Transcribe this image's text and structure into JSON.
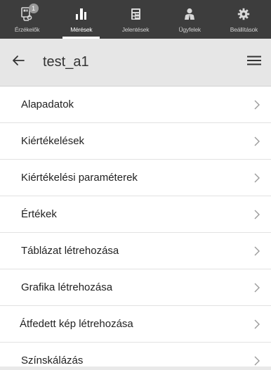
{
  "nav": {
    "items": [
      {
        "label": "Érzékelők",
        "icon": "sensor-icon",
        "badge": "1",
        "active": false
      },
      {
        "label": "Mérések",
        "icon": "bar-chart-icon",
        "active": true
      },
      {
        "label": "Jelentések",
        "icon": "report-icon",
        "active": false
      },
      {
        "label": "Ügyfelek",
        "icon": "clients-icon",
        "active": false
      },
      {
        "label": "Beállítások",
        "icon": "gear-icon",
        "active": false
      }
    ]
  },
  "header": {
    "title": "test_a1",
    "back_icon": "arrow-left-icon",
    "menu_icon": "hamburger-menu-icon"
  },
  "menu": {
    "items": [
      {
        "label": "Alapadatok"
      },
      {
        "label": "Kiértékelések"
      },
      {
        "label": "Kiértékelési paraméterek"
      },
      {
        "label": "Értékek"
      },
      {
        "label": "Táblázat létrehozása"
      },
      {
        "label": "Grafika létrehozása"
      },
      {
        "label": "Átfedett kép létrehozása"
      },
      {
        "label": "Színskálázás"
      }
    ]
  },
  "colors": {
    "nav_bg": "#3d3d3d",
    "header_bg": "#e6e6e6",
    "text": "#222222",
    "chevron": "#9a9a9a"
  }
}
